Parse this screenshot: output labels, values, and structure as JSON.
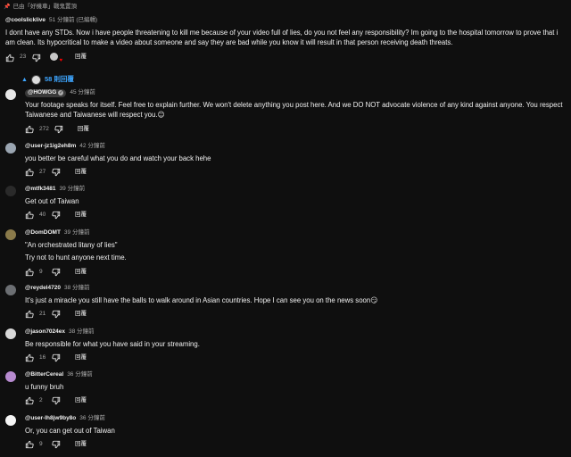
{
  "pinned_label": "已由「好機車」戰鬼置頂",
  "top_comment": {
    "author": "@coolslicklive",
    "time": "51 分鐘前 (已編輯)",
    "text": "I dont have any STDs. Now i have people threatening to kill me because of your video full of lies, do you not feel any responsibility? Im going to the hospital tomorrow to prove that i am clean. Its hypocritical to make a video about someone and say they are bad while you know it will result in that person receiving death threats.",
    "likes": "23",
    "reply_label": "回覆"
  },
  "replies_toggle_label": "58 則回覆",
  "replies": [
    {
      "author": "@HOWGG",
      "time": "45 分鐘前",
      "lines": [
        "Your footage speaks for itself. Feel free to explain further. We won't delete anything you post here. And we DO NOT advocate violence of any kind against anyone. You respect Taiwanese and Taiwanese will respect you.😊"
      ],
      "likes": "272",
      "reply_label": "回覆",
      "avatar_color": "#e8e8e8"
    },
    {
      "author": "@user-jz1ig2eh8m",
      "time": "42 分鐘前",
      "lines": [
        "you better be careful what you do and watch your back hehe"
      ],
      "likes": "27",
      "reply_label": "回覆",
      "avatar_color": "#9aa5b1"
    },
    {
      "author": "@mtfk3481",
      "time": "39 分鐘前",
      "lines": [
        "Get out of Taiwan"
      ],
      "likes": "40",
      "reply_label": "回覆",
      "avatar_color": "#2a2a2a"
    },
    {
      "author": "@DomDOMT",
      "time": "39 分鐘前",
      "lines": [
        "\"An orchestrated litany of lies\"",
        "Try not to hunt anyone next time."
      ],
      "likes": "9",
      "reply_label": "回覆",
      "avatar_color": "#8a7a4a"
    },
    {
      "author": "@reydel4720",
      "time": "38 分鐘前",
      "lines": [
        "It's just a miracle you still have the balls to walk around in Asian countries. Hope I can see you on the news soon😏"
      ],
      "likes": "21",
      "reply_label": "回覆",
      "avatar_color": "#6c6f73"
    },
    {
      "author": "@jason7024ex",
      "time": "38 分鐘前",
      "lines": [
        "Be responsible for what you have said in your streaming."
      ],
      "likes": "16",
      "reply_label": "回覆",
      "avatar_color": "#d9d9d9"
    },
    {
      "author": "@BitterCereal",
      "time": "36 分鐘前",
      "lines": [
        "u funny bruh"
      ],
      "likes": "2",
      "reply_label": "回覆",
      "avatar_color": "#b78bd0"
    },
    {
      "author": "@user-lh8jw9by8o",
      "time": "36 分鐘前",
      "lines": [
        "Or, you can get out of Taiwan"
      ],
      "likes": "9",
      "reply_label": "回覆",
      "avatar_color": "#f5f5f5"
    }
  ]
}
